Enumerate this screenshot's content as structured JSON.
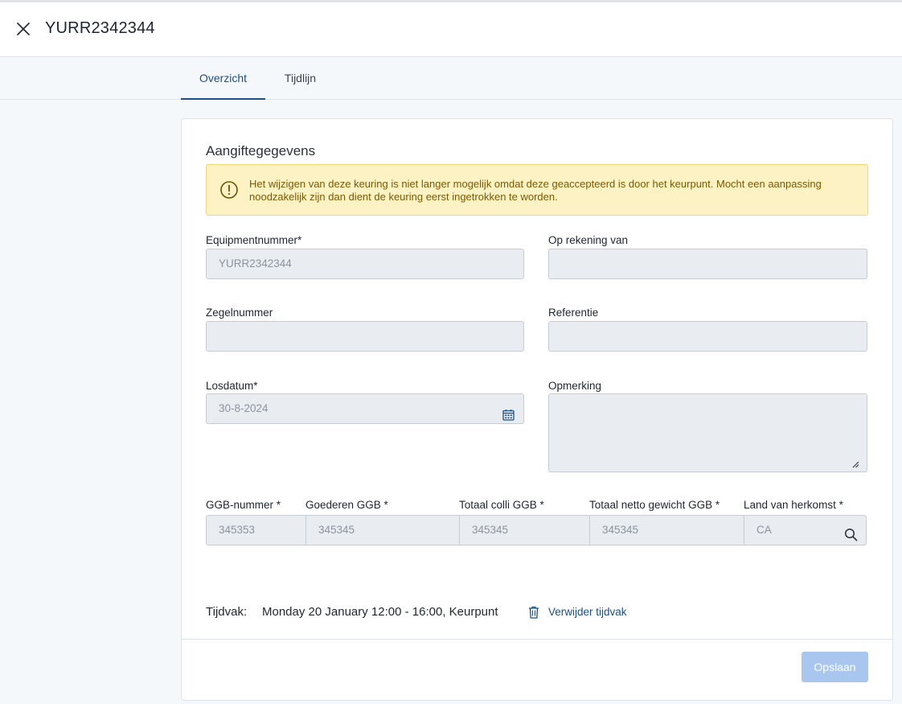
{
  "header": {
    "title": "YURR2342344"
  },
  "tabs": [
    {
      "label": "Overzicht",
      "active": true
    },
    {
      "label": "Tijdlijn",
      "active": false
    }
  ],
  "section": {
    "title": "Aangiftegegevens"
  },
  "alert": {
    "text": "Het wijzigen van deze keuring is niet langer mogelijk omdat deze geaccepteerd is door het keurpunt. Mocht een aanpassing noodzakelijk zijn dan dient de keuring eerst ingetrokken te worden."
  },
  "fields": {
    "equipmentnummer": {
      "label": "Equipmentnummer*",
      "value": "YURR2342344"
    },
    "op_rekening_van": {
      "label": "Op rekening van",
      "value": ""
    },
    "zegelnummer": {
      "label": "Zegelnummer",
      "value": ""
    },
    "referentie": {
      "label": "Referentie",
      "value": ""
    },
    "losdatum": {
      "label": "Losdatum*",
      "value": "30-8-2024"
    },
    "opmerking": {
      "label": "Opmerking",
      "value": ""
    },
    "ggb_nummer": {
      "label": "GGB-nummer *",
      "value": "345353"
    },
    "goederen_ggb": {
      "label": "Goederen GGB *",
      "value": "345345"
    },
    "totaal_colli_ggb": {
      "label": "Totaal colli GGB *",
      "value": "345345"
    },
    "totaal_netto_gewicht_ggb": {
      "label": "Totaal netto gewicht GGB *",
      "value": "345345"
    },
    "land_van_herkomst": {
      "label": "Land van herkomst *",
      "value": "CA"
    }
  },
  "tijdvak": {
    "label": "Tijdvak:",
    "value": "Monday 20 January 12:00 - 16:00, Keurpunt",
    "remove_label": "Verwijder tijdvak"
  },
  "footer": {
    "save_label": "Opslaan"
  },
  "colors": {
    "accent": "#1b4f8a",
    "alert_bg": "#fdf2c4",
    "alert_text": "#7a5a00",
    "disabled_button": "#a9c7ee",
    "field_bg": "#e9edf1"
  }
}
